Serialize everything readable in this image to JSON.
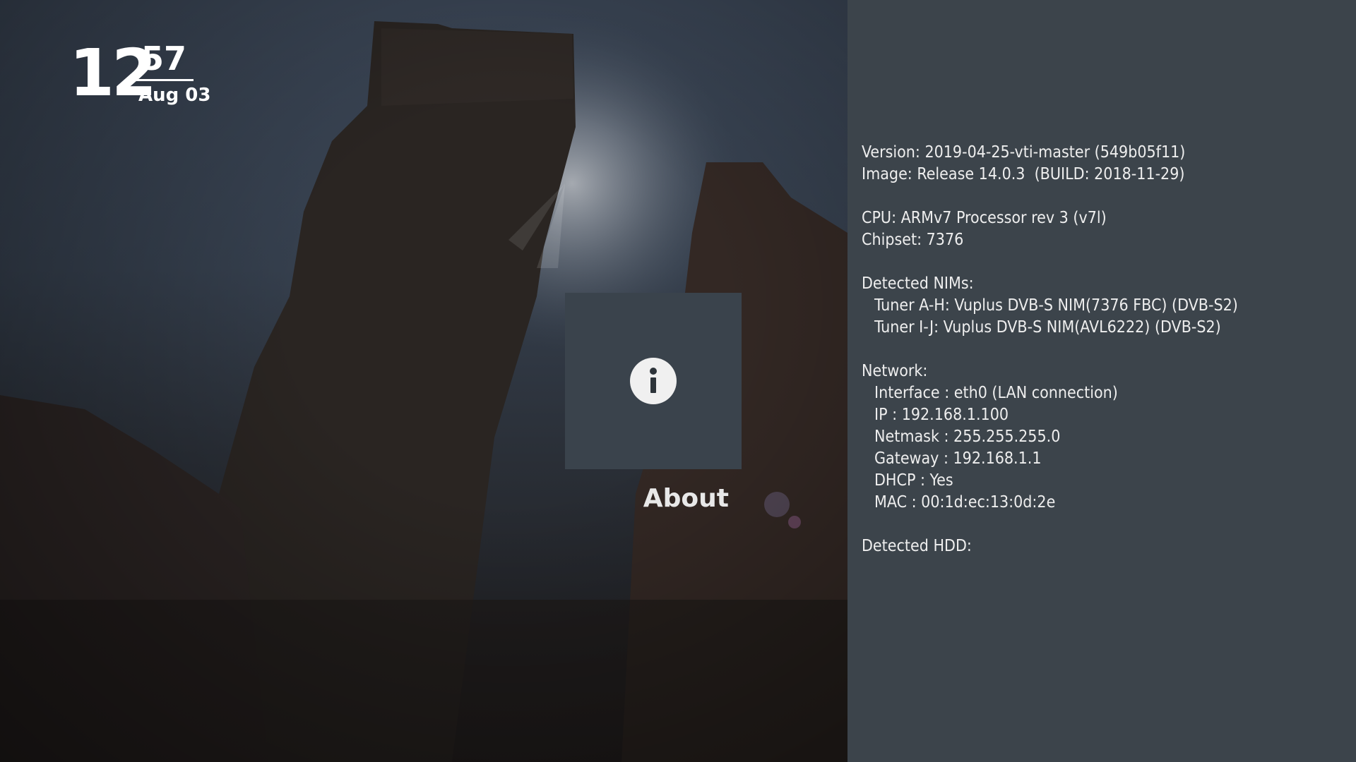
{
  "clock": {
    "hour": "12",
    "minute": "57",
    "date": "Aug 03"
  },
  "menu": {
    "selected_label": "About",
    "icon": "info-icon",
    "icon_glyph": "i"
  },
  "info": {
    "version": "Version: 2019-04-25-vti-master (549b05f11)",
    "image": "Image: Release 14.0.3  (BUILD: 2018-11-29)",
    "cpu": "CPU: ARMv7 Processor rev 3 (v7l)",
    "chipset": "Chipset: 7376",
    "nims_header": "Detected NIMs:",
    "tuner_1": "Tuner A-H: Vuplus DVB-S NIM(7376 FBC) (DVB-S2)",
    "tuner_2": "Tuner I-J: Vuplus DVB-S NIM(AVL6222) (DVB-S2)",
    "network_header": "Network:",
    "interface": "Interface : eth0 (LAN connection)",
    "ip": "IP : 192.168.1.100",
    "netmask": "Netmask : 255.255.255.0",
    "gateway": "Gateway : 192.168.1.1",
    "dhcp": "DHCP : Yes",
    "mac": "MAC : 00:1d:ec:13:0d:2e",
    "hdd_header": "Detected HDD:"
  },
  "colors": {
    "panel_bg": "#3c444b",
    "tile_bg": "#3a434c",
    "text": "#eeeeee"
  }
}
